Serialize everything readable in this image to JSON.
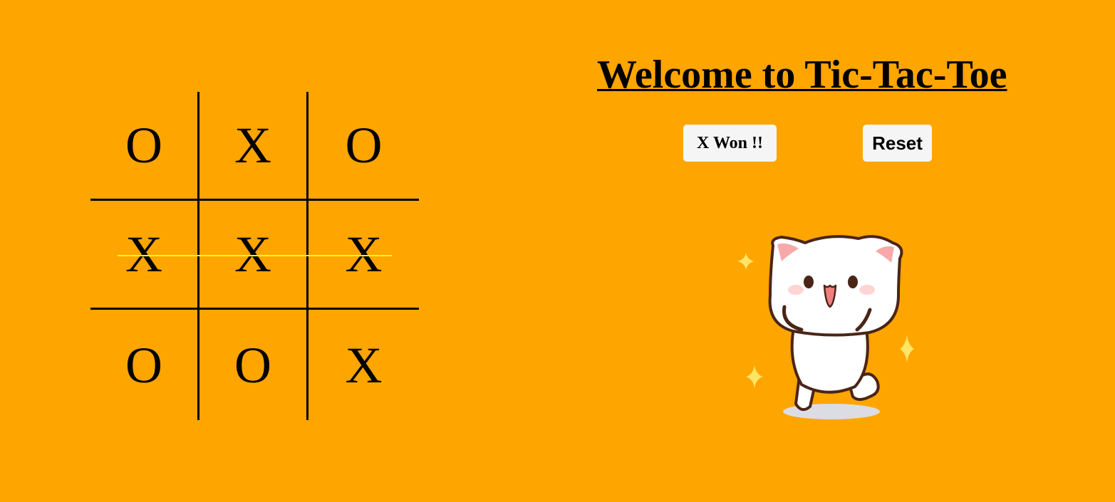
{
  "title": "Welcome to Tic-Tac-Toe",
  "status_label": "X Won !!",
  "reset_label": "Reset",
  "board": {
    "cells": [
      [
        "O",
        "X",
        "O"
      ],
      [
        "X",
        "X",
        "X"
      ],
      [
        "O",
        "O",
        "X"
      ]
    ],
    "winning_row": 1
  },
  "colors": {
    "background": "#ffa500",
    "grid_line": "#000000",
    "win_line": "#ffff00",
    "button_bg": "#f5f5f5"
  },
  "illustration": "celebrating-cat"
}
